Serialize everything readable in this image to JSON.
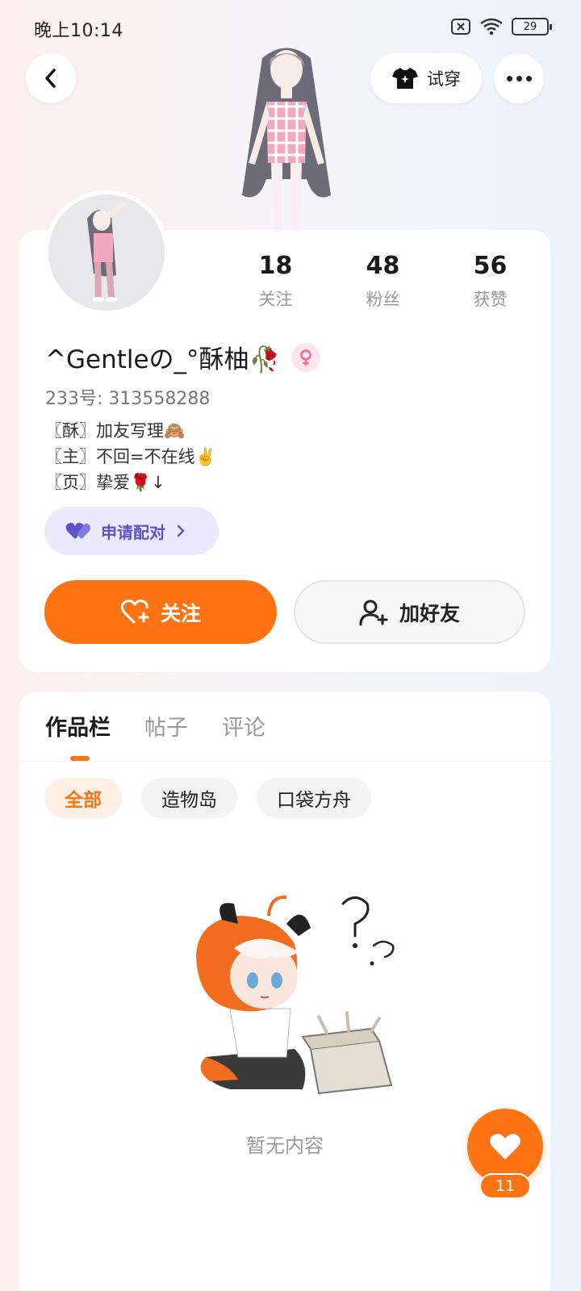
{
  "status_bar": {
    "time": "晚上10:14",
    "battery": "29"
  },
  "header": {
    "tryon_label": "试穿"
  },
  "profile": {
    "stats": [
      {
        "value": "18",
        "label": "关注"
      },
      {
        "value": "48",
        "label": "粉丝"
      },
      {
        "value": "56",
        "label": "获赞"
      }
    ],
    "username": "^Gentleの_°酥柚🥀",
    "uid": "233号: 313558288",
    "bio": [
      "〖酥〗加友写理🙈",
      "〖主〗不回=不在线✌️",
      "〖页〗挚爱🌹↓"
    ],
    "pair_label": "申请配对",
    "follow_label": "关注",
    "add_friend_label": "加好友"
  },
  "content": {
    "tabs": [
      "作品栏",
      "帖子",
      "评论"
    ],
    "active_tab": 0,
    "chips": [
      "全部",
      "造物岛",
      "口袋方舟"
    ],
    "active_chip": 0,
    "empty_text": "暂无内容"
  },
  "like_fab": {
    "count": "11"
  },
  "colors": {
    "accent": "#ff7313",
    "pair": "#5b55c8"
  }
}
